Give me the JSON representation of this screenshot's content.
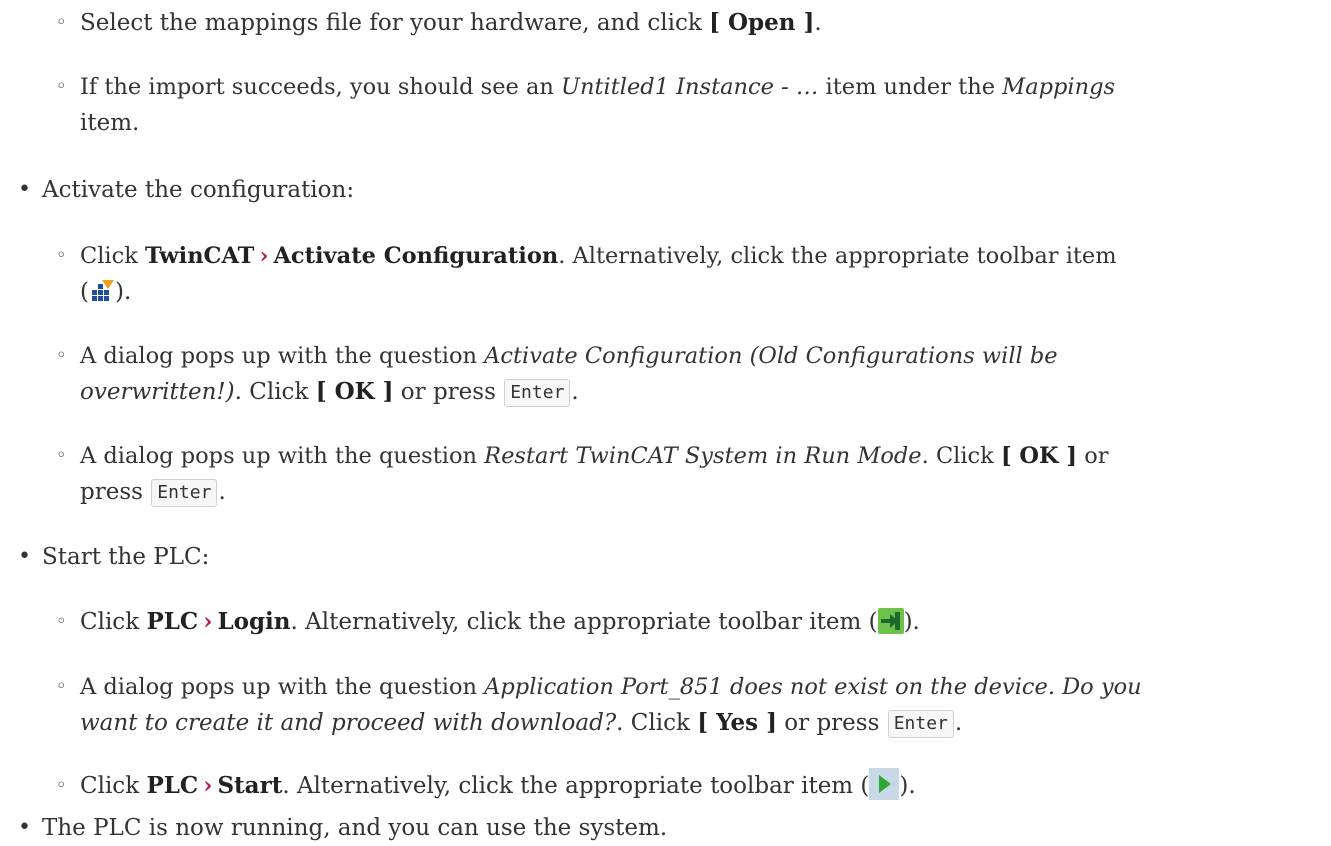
{
  "bullets": {
    "disc": "•",
    "circle": "◦"
  },
  "arrow": "›",
  "kbd_enter": "Enter",
  "l1": {
    "a": "Select the mappings file for your hardware, and click ",
    "b": "[ Open ]",
    "c": "."
  },
  "l2": {
    "a": "If the import succeeds, you should see an ",
    "b": "Untitled1 Instance - …",
    "c": " item under the ",
    "d": "Mappings"
  },
  "l2b": "item.",
  "l3": "Activate the configuration:",
  "l4": {
    "a": "Click ",
    "b1": "TwinCAT",
    "b2": "Activate Configuration",
    "c": ". Alternatively, click the appropriate toolbar item"
  },
  "l4b": {
    "open": "(",
    "close": ")."
  },
  "l5": {
    "a": "A dialog pops up with the question ",
    "b": "Activate Configuration (Old Configurations will be"
  },
  "l5b": {
    "a": "overwritten!)",
    "b": ". Click ",
    "c": "[ OK ]",
    "d": " or press ",
    "e": "."
  },
  "l6": {
    "a": "A dialog pops up with the question ",
    "b": "Restart TwinCAT System in Run Mode",
    "c": ". Click ",
    "d": "[ OK ]",
    "e": " or"
  },
  "l6b": {
    "a": "press ",
    "b": "."
  },
  "l7": "Start the PLC:",
  "l8": {
    "a": "Click ",
    "b1": "PLC",
    "b2": "Login",
    "c": ". Alternatively, click the appropriate toolbar item (",
    "d": ")."
  },
  "l9": {
    "a": "A dialog pops up with the question ",
    "b": "Application Port_851 does not exist on the device. Do you"
  },
  "l9b": {
    "a": "want to create it and proceed with download?",
    "b": ". Click ",
    "c": "[ Yes ]",
    "d": " or press ",
    "e": "."
  },
  "l10": {
    "a": "Click ",
    "b1": "PLC",
    "b2": "Start",
    "c": ". Alternatively, click the appropriate toolbar item (",
    "d": ")."
  },
  "l11": "The PLC is now running, and you can use the system.",
  "icons": [
    "activate-configuration-icon",
    "plc-login-icon",
    "plc-start-icon"
  ]
}
